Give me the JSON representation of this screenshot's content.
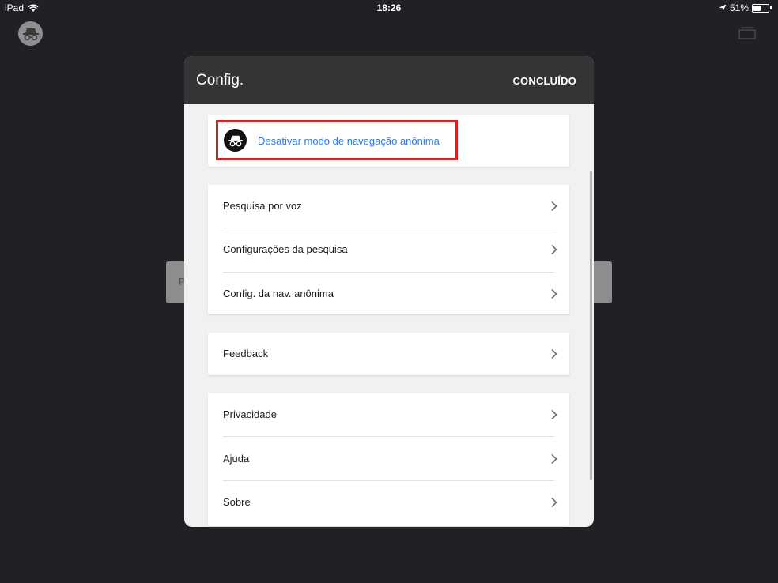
{
  "status_bar": {
    "device": "iPad",
    "time": "18:26",
    "battery_percent": "51%",
    "battery_level": 0.51,
    "icons": [
      "wifi-icon",
      "location-arrow-icon",
      "battery-icon"
    ]
  },
  "browser": {
    "partial_text": "P",
    "icons": [
      "incognito-icon",
      "tabs-icon"
    ]
  },
  "dialog": {
    "title": "Config.",
    "done_label": "CONCLUÍDO",
    "incognito": {
      "label": "Desativar modo de navegação anônima",
      "icon": "incognito-icon",
      "label_color": "#2f7be2",
      "highlight_color": "#e02020"
    },
    "group1": [
      {
        "label": "Pesquisa por voz"
      },
      {
        "label": "Configurações da pesquisa"
      },
      {
        "label": "Config. da nav. anônima"
      }
    ],
    "group2": [
      {
        "label": "Feedback"
      }
    ],
    "group3": [
      {
        "label": "Privacidade"
      },
      {
        "label": "Ajuda"
      },
      {
        "label": "Sobre"
      }
    ]
  },
  "colors": {
    "background": "#202124",
    "header": "#343434",
    "panel": "#f1f1f1"
  }
}
